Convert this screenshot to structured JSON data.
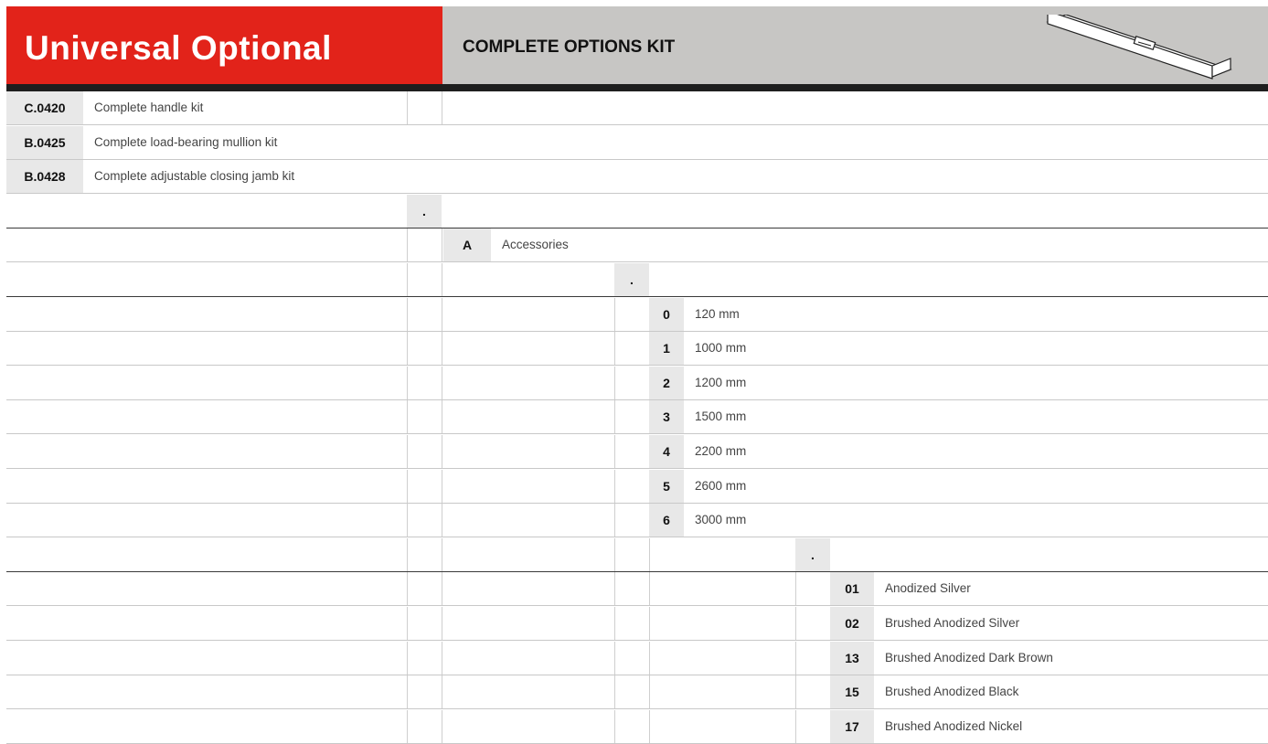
{
  "header": {
    "brand": "Universal Optional",
    "subtitle": "COMPLETE OPTIONS KIT",
    "image_icon": "aluminium-bar-icon",
    "brand_color": "#e2231a",
    "band_color": "#c7c6c4"
  },
  "kits": [
    {
      "code": "C.0420",
      "label": "Complete handle kit"
    },
    {
      "code": "B.0425",
      "label": "Complete load-bearing mullion kit"
    },
    {
      "code": "B.0428",
      "label": "Complete adjustable closing jamb kit"
    }
  ],
  "separator_1": ".",
  "accessory": {
    "code": "A",
    "label": "Accessories"
  },
  "separator_2": ".",
  "lengths": [
    {
      "code": "0",
      "label": "120 mm"
    },
    {
      "code": "1",
      "label": "1000 mm"
    },
    {
      "code": "2",
      "label": "1200 mm"
    },
    {
      "code": "3",
      "label": "1500 mm"
    },
    {
      "code": "4",
      "label": "2200 mm"
    },
    {
      "code": "5",
      "label": "2600 mm"
    },
    {
      "code": "6",
      "label": "3000 mm"
    }
  ],
  "separator_3": ".",
  "finishes": [
    {
      "code": "01",
      "label": "Anodized Silver"
    },
    {
      "code": "02",
      "label": "Brushed Anodized Silver"
    },
    {
      "code": "13",
      "label": "Brushed Anodized Dark Brown"
    },
    {
      "code": "15",
      "label": "Brushed Anodized Black"
    },
    {
      "code": "17",
      "label": "Brushed Anodized Nickel"
    }
  ]
}
